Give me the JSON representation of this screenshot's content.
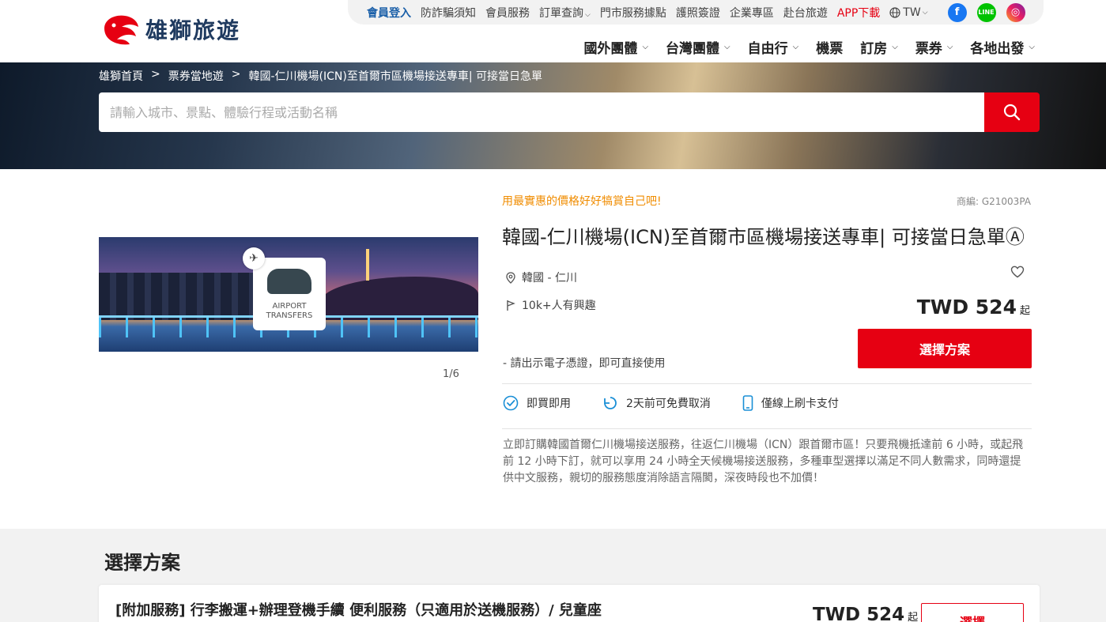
{
  "header": {
    "brand": "雄獅旅遊",
    "topbar": {
      "login": "會員登入",
      "items": [
        "防詐騙須知",
        "會員服務",
        "訂單查詢",
        "門市服務據點",
        "護照簽證",
        "企業專區",
        "赴台旅遊"
      ],
      "app": "APP下載",
      "region": "TW"
    },
    "social": {
      "facebook": "f",
      "line": "LINE",
      "instagram": "◎"
    },
    "nav": [
      "國外團體",
      "台灣團體",
      "自由行",
      "機票",
      "訂房",
      "票券",
      "各地出發"
    ]
  },
  "breadcrumb": [
    "雄獅首頁",
    "票券當地遊",
    "韓國-仁川機場(ICN)至首爾市區機場接送專車| 可接當日急單"
  ],
  "breadcrumb_sep": ">",
  "search": {
    "placeholder": "請輸入城市、景點、體驗行程或活動名稱"
  },
  "gallery": {
    "card_text": [
      "AIRPORT",
      "TRANSFERS"
    ],
    "counter": "1/6"
  },
  "product": {
    "promo": "用最實惠的價格好好犒賞自己吧!",
    "code": "商編: G21003PA",
    "title": "韓國-仁川機場(ICN)至首爾市區機場接送專車| 可接當日急單Ⓐ",
    "location": "韓國 - 仁川",
    "interest": "10k+人有興趣",
    "price": "TWD 524",
    "price_suffix": "起",
    "voucher": "- 請出示電子憑證，即可直接使用",
    "select_label": "選擇方案",
    "features": [
      "即買即用",
      "2天前可免費取消",
      "僅線上刷卡支付"
    ],
    "description": "立即訂購韓國首爾仁川機場接送服務，往返仁川機場（ICN）跟首爾市區！只要飛機抵達前 6 小時，或起飛前 12 小時下訂，就可以享用 24 小時全天候機場接送服務，多種車型選擇以滿足不同人數需求，同時還提供中文服務，親切的服務態度消除語言隔閡，深夜時段也不加價！"
  },
  "plans": {
    "title": "選擇方案",
    "items": [
      {
        "name": "[附加服務] 行李搬運+辦理登機手續 便利服務（只適用於送機服務）/ 兒童座",
        "price": "TWD 524",
        "price_suffix": "起",
        "button": "選擇"
      }
    ]
  },
  "colors": {
    "brand_red": "#e60012",
    "promo_orange": "#f08c00",
    "login_blue": "#1a5fa8"
  }
}
